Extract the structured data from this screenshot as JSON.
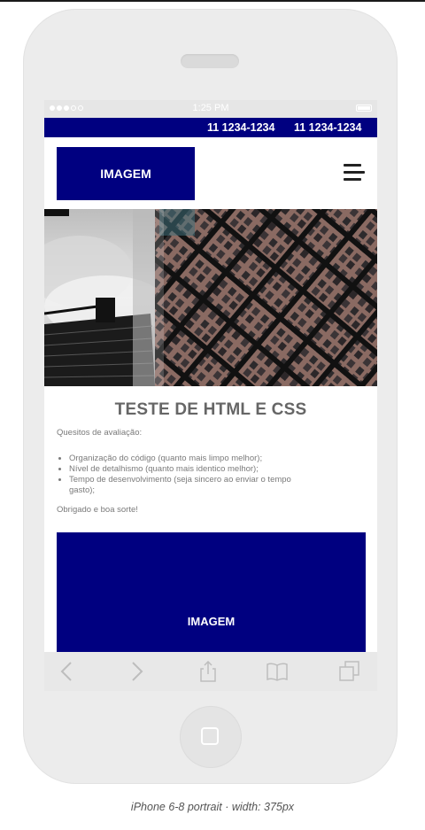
{
  "status_bar": {
    "time": "1:25 PM"
  },
  "topbar": {
    "phone_1": "11 1234-1234",
    "phone_2": "11 1234-1234"
  },
  "header": {
    "logo_label": "IMAGEM"
  },
  "content": {
    "title": "TESTE DE HTML E CSS",
    "intro": "Quesitos de avaliação:",
    "items": [
      "Organização do código (quanto mais limpo melhor);",
      "Nível de detalhismo (quanto mais identico melhor);",
      "Tempo de desenvolvimento (seja sincero ao enviar o tempo gasto);"
    ],
    "outro": "Obrigado e boa sorte!",
    "image_label": "IMAGEM"
  },
  "toolbar": {
    "icons": [
      "back-icon",
      "forward-icon",
      "share-icon",
      "bookmarks-icon",
      "tabs-icon"
    ]
  },
  "caption": "iPhone 6-8 portrait · width: 375px",
  "colors": {
    "brand_blue": "#000080",
    "text_gray": "#666666"
  }
}
